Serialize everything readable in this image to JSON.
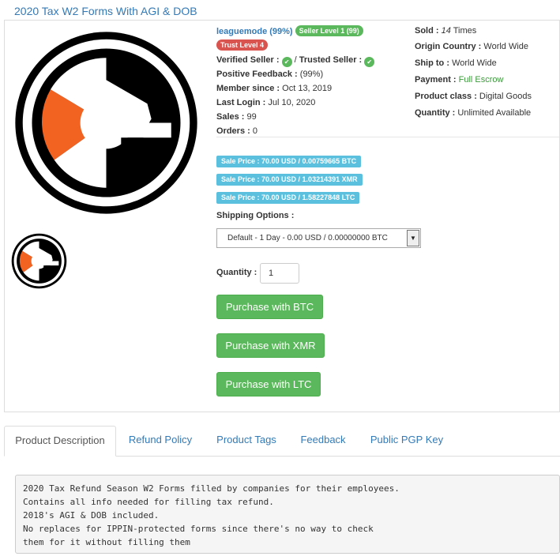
{
  "product": {
    "title": "2020 Tax W2 Forms With AGI & DOB"
  },
  "vendor": {
    "name_link": "leaguemode (99%)",
    "seller_level": "Seller Level 1 (99)",
    "trust_level": "Trust Level 4",
    "verified_label": "Verified Seller :",
    "trusted_sep": "/",
    "trusted_label": "Trusted Seller :",
    "positive_label": "Positive Feedback :",
    "positive_value": "(99%)",
    "member_label": "Member since :",
    "member_value": "Oct 13, 2019",
    "login_label": "Last Login :",
    "login_value": "Jul 10, 2020",
    "sales_label": "Sales :",
    "sales_value": "99",
    "orders_label": "Orders :",
    "orders_value": "0"
  },
  "info": {
    "sold_label": "Sold :",
    "sold_value": "14",
    "sold_suffix": "Times",
    "origin_label": "Origin Country :",
    "origin_value": "World Wide",
    "ship_label": "Ship to :",
    "ship_value": "World Wide",
    "payment_label": "Payment :",
    "payment_value": "Full Escrow",
    "class_label": "Product class :",
    "class_value": "Digital Goods",
    "quantity_label": "Quantity :",
    "quantity_value": "Unlimited Available"
  },
  "prices": [
    "Sale Price : 70.00 USD / 0.00759665 BTC",
    "Sale Price : 70.00 USD / 1.03214391 XMR",
    "Sale Price : 70.00 USD / 1.58227848 LTC"
  ],
  "shipping": {
    "label": "Shipping Options :",
    "selected": "Default - 1 Day - 0.00 USD / 0.00000000 BTC"
  },
  "quantity": {
    "label": "Quantity :",
    "value": "1"
  },
  "buttons": {
    "btc": "Purchase with BTC",
    "xmr": "Purchase with XMR",
    "ltc": "Purchase with LTC"
  },
  "tabs": [
    "Product Description",
    "Refund Policy",
    "Product Tags",
    "Feedback",
    "Public PGP Key"
  ],
  "description": [
    "2020 Tax Refund Season W2 Forms filled by companies for their employees.",
    "Contains all info needed for filling tax refund.",
    "2018's AGI & DOB included.",
    "No replaces for IPPIN-protected forms since there's no way to check",
    "them for it without filling them"
  ],
  "colors": {
    "link": "#337ab7",
    "success": "#5cb85c",
    "danger": "#d9534f",
    "info": "#5bc0de",
    "logo_orange": "#f26322"
  }
}
